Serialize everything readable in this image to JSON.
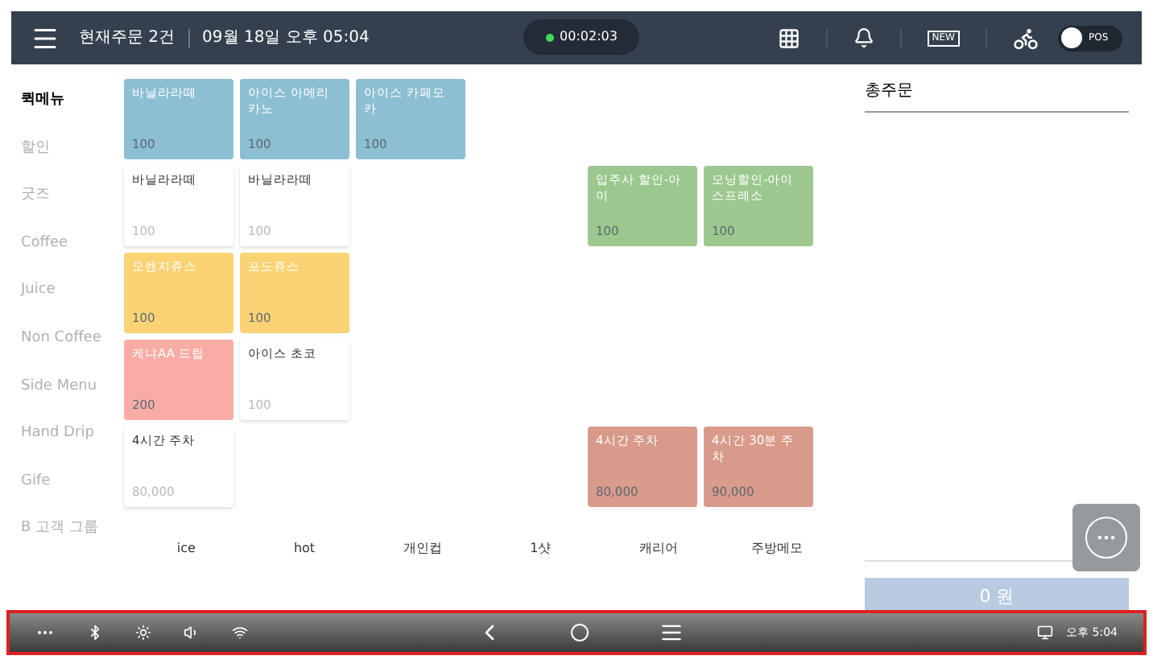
{
  "top_bar": {
    "order_count": "현재주문 2건",
    "datetime": "09월 18일 오후 05:04",
    "timer": "00:02:03",
    "badge": "NEW",
    "toggle": {
      "label": "POS"
    }
  },
  "categories": [
    {
      "label": "퀵메뉴",
      "selected": true
    },
    {
      "label": "할인",
      "selected": false
    },
    {
      "label": "굿즈",
      "selected": false
    },
    {
      "label": "Coffee",
      "selected": false
    },
    {
      "label": "Juice",
      "selected": false
    },
    {
      "label": "Non Coffee",
      "selected": false
    },
    {
      "label": "Side Menu",
      "selected": false
    },
    {
      "label": "Hand Drip",
      "selected": false
    },
    {
      "label": "Gife",
      "selected": false
    },
    {
      "label": "B 고객 그룹",
      "selected": false
    }
  ],
  "menu_grid": [
    {
      "kind": "item",
      "name": "바닐라라떼",
      "price": "100",
      "color": "#8dbfd3"
    },
    {
      "kind": "item",
      "name": "아이스 아메리카노",
      "price": "100",
      "color": "#8dbfd3"
    },
    {
      "kind": "item",
      "name": "아이스 카페모카",
      "price": "100",
      "color": "#8dbfd3"
    },
    {
      "kind": "empty"
    },
    {
      "kind": "empty"
    },
    {
      "kind": "empty"
    },
    {
      "kind": "item",
      "name": "바닐라라떼",
      "price": "100",
      "color": "#ffffff"
    },
    {
      "kind": "item",
      "name": "바닐라라떼",
      "price": "100",
      "color": "#ffffff"
    },
    {
      "kind": "empty"
    },
    {
      "kind": "empty"
    },
    {
      "kind": "item",
      "name": "입주사 할인-아이",
      "price": "100",
      "color": "#9cc88f"
    },
    {
      "kind": "item",
      "name": "모닝할인-아이스프레소",
      "price": "100",
      "color": "#9cc88f"
    },
    {
      "kind": "item",
      "name": "오렌지쥬스",
      "price": "100",
      "color": "#fbd374"
    },
    {
      "kind": "item",
      "name": "포도쥬스",
      "price": "100",
      "color": "#fbd374"
    },
    {
      "kind": "empty"
    },
    {
      "kind": "empty"
    },
    {
      "kind": "empty"
    },
    {
      "kind": "empty"
    },
    {
      "kind": "item",
      "name": "케냐AA 드립",
      "price": "200",
      "color": "#f8aca5"
    },
    {
      "kind": "item",
      "name": "아이스 초코",
      "price": "100",
      "color": "#ffffff"
    },
    {
      "kind": "empty"
    },
    {
      "kind": "empty"
    },
    {
      "kind": "empty"
    },
    {
      "kind": "empty"
    },
    {
      "kind": "item",
      "name": "4시간 주차",
      "price": "80,000",
      "color": "#ffffff"
    },
    {
      "kind": "empty"
    },
    {
      "kind": "empty"
    },
    {
      "kind": "empty"
    },
    {
      "kind": "item",
      "name": "4시간 주차",
      "price": "80,000",
      "color": "#d89a8a"
    },
    {
      "kind": "item",
      "name": "4시간 30분 주차",
      "price": "90,000",
      "color": "#d89a8a"
    }
  ],
  "options": [
    "ice",
    "hot",
    "개인컵",
    "1샷",
    "캐리어",
    "주방메모"
  ],
  "order_panel": {
    "title": "총주문",
    "total": "0 원"
  },
  "nav_bar": {
    "clock": "오후 5:04"
  }
}
